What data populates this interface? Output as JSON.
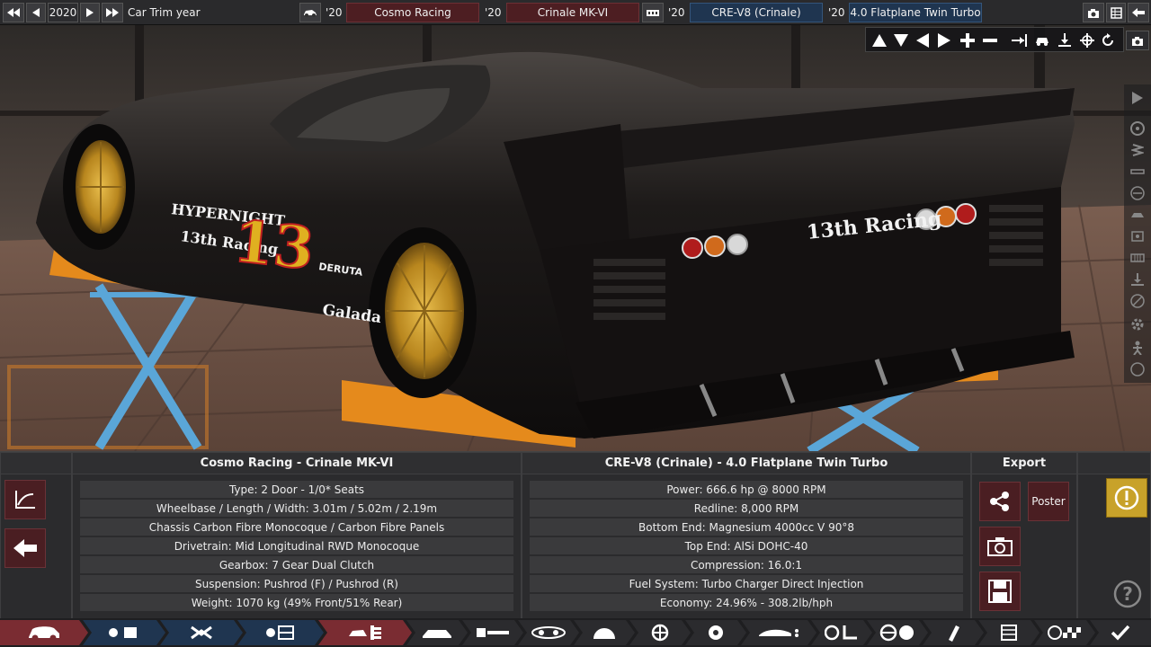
{
  "topbar": {
    "year": "2020",
    "trim_label": "Car Trim year",
    "model_year": "'20",
    "brand": "Cosmo Racing",
    "model_year2": "'20",
    "model": "Crinale MK-VI",
    "engine_year": "'20",
    "engine_family": "CRE-V8 (Crinale)",
    "engine_year2": "'20",
    "engine_variant": "4.0 Flatplane Twin Turbo"
  },
  "car_info": {
    "title": "Cosmo Racing - Crinale MK-VI",
    "rows": [
      "Type: 2 Door - 1/0* Seats",
      "Wheelbase / Length / Width: 3.01m / 5.02m / 2.19m",
      "Chassis Carbon Fibre Monocoque / Carbon Fibre Panels",
      "Drivetrain: Mid Longitudinal RWD Monocoque",
      "Gearbox: 7 Gear Dual Clutch",
      "Suspension: Pushrod (F) / Pushrod (R)",
      "Weight: 1070 kg (49% Front/51% Rear)"
    ]
  },
  "engine_info": {
    "title": "CRE-V8 (Crinale) - 4.0 Flatplane Twin Turbo",
    "rows": [
      "Power: 666.6 hp @ 8000 RPM",
      "Redline:  8,000 RPM",
      "Bottom End: Magnesium 4000cc V 90°8",
      "Top End: AlSi DOHC-40",
      "Compression: 16.0:1",
      "Fuel System: Turbo Charger Direct Injection",
      "Economy: 24.96% - 308.2lb/hph"
    ]
  },
  "export": {
    "title": "Export",
    "poster_label": "Poster"
  },
  "help": {
    "label": "?"
  },
  "livery": {
    "brand_text": "HYPERNIGHT",
    "team_text": "13th Racing",
    "number": "13",
    "sponsor1": "DERUTA",
    "sponsor2": "Galada",
    "rear_text": "13th Racing"
  },
  "colors": {
    "accent_red": "#4d1e22",
    "accent_blue": "#1f3550",
    "warning_yellow": "#c8a22a",
    "car_body": "#1a1716",
    "wheel_gold": "#c9962a",
    "lift_orange": "#e58a1c",
    "lift_blue": "#5aa6d8"
  },
  "icons": {
    "view_controls": [
      "arrow-up-icon",
      "arrow-down-icon",
      "arrow-left-icon",
      "arrow-right-icon",
      "zoom-in-icon",
      "zoom-out-icon",
      "snap-icon",
      "car-view-icon",
      "ground-icon",
      "rotate-axis-icon",
      "reset-icon",
      "camera-icon"
    ],
    "side_strip": [
      "play-icon",
      "wheel-icon",
      "spring-icon",
      "suspension-icon",
      "brake-icon",
      "body-icon",
      "interior-icon",
      "grille-icon",
      "lift-icon",
      "no-entry-icon",
      "gear-icon",
      "person-icon",
      "circle-icon"
    ],
    "nav": [
      "car-icon",
      "chassis-icon",
      "engine-block-icon",
      "engine-parts-icon",
      "engine-tune-icon",
      "body-icon",
      "exhaust-icon",
      "turbo-icon",
      "gauge-icon",
      "wheel-icon",
      "brake-disc-icon",
      "aero-icon",
      "suspension-icon",
      "steering-icon",
      "fuel-icon",
      "spreadsheet-icon",
      "finish-flag-icon",
      "confirm-icon"
    ]
  }
}
